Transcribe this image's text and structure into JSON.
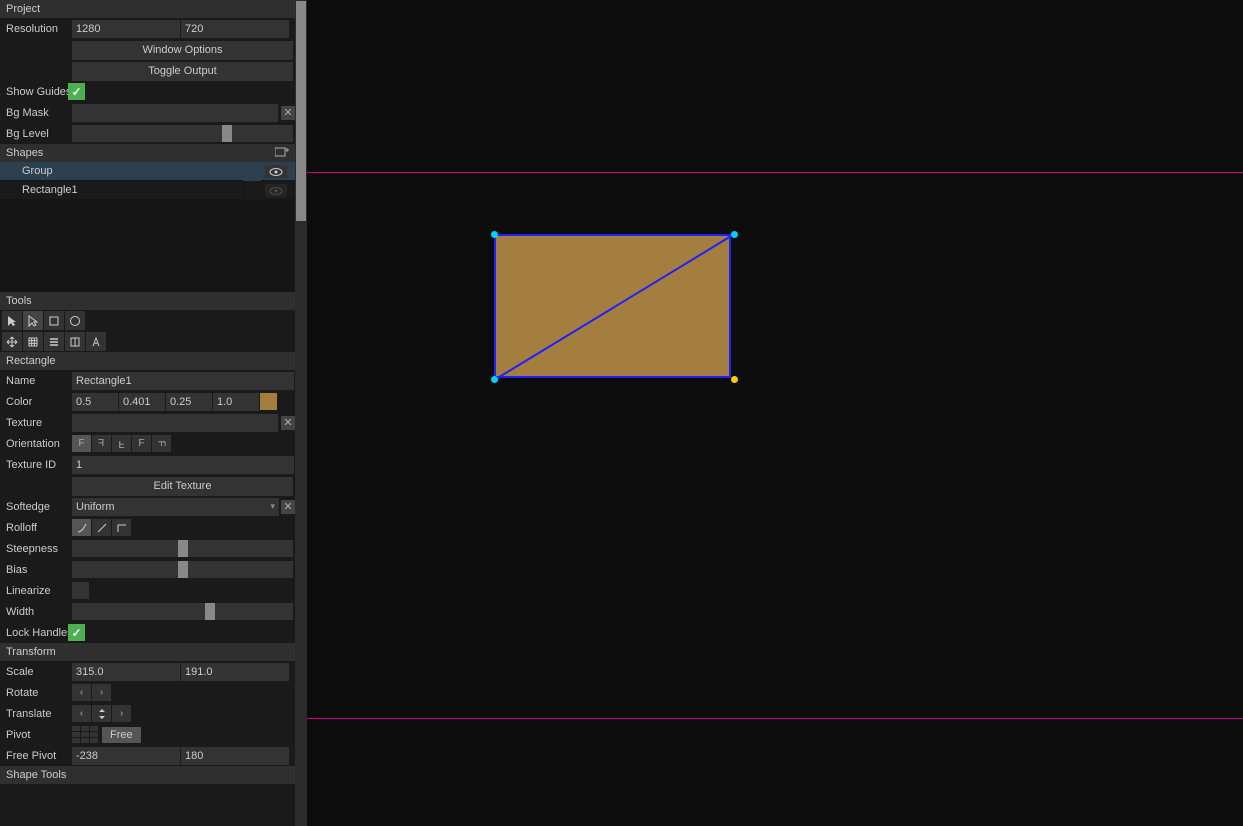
{
  "project": {
    "header": "Project",
    "resolution_label": "Resolution",
    "res_w": "1280",
    "res_h": "720",
    "window_options": "Window Options",
    "toggle_output": "Toggle Output",
    "show_guides_label": "Show Guides",
    "bg_mask_label": "Bg Mask",
    "bg_mask_val": "",
    "bg_level_label": "Bg Level"
  },
  "shapes": {
    "header": "Shapes",
    "items": [
      "Group",
      "Rectangle1"
    ]
  },
  "tools": {
    "header": "Tools"
  },
  "rectangle": {
    "header": "Rectangle",
    "name_label": "Name",
    "name_val": "Rectangle1",
    "color_label": "Color",
    "color_r": "0.5",
    "color_g": "0.401",
    "color_b": "0.25",
    "color_a": "1.0",
    "swatch": "#a37e3f",
    "texture_label": "Texture",
    "texture_val": "",
    "orientation_label": "Orientation",
    "texture_id_label": "Texture ID",
    "texture_id_val": "1",
    "edit_texture": "Edit Texture",
    "softedge_label": "Softedge",
    "softedge_val": "Uniform",
    "rolloff_label": "Rolloff",
    "steepness_label": "Steepness",
    "bias_label": "Bias",
    "linearize_label": "Linearize",
    "width_label": "Width",
    "lock_handles_label": "Lock Handles"
  },
  "transform": {
    "header": "Transform",
    "scale_label": "Scale",
    "scale_x": "315.0",
    "scale_y": "191.0",
    "rotate_label": "Rotate",
    "translate_label": "Translate",
    "pivot_label": "Pivot",
    "pivot_free": "Free",
    "free_pivot_label": "Free Pivot",
    "free_pivot_x": "-238",
    "free_pivot_y": "180"
  },
  "shape_tools": {
    "header": "Shape Tools"
  }
}
